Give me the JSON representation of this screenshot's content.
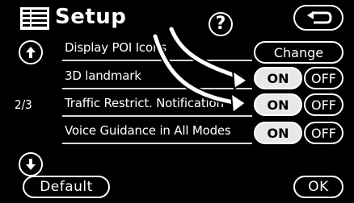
{
  "header": {
    "title": "Setup",
    "help_label": "?",
    "icons": [
      "menu-list-icon",
      "back-arrow-icon"
    ]
  },
  "nav": {
    "page_indicator": "2/3",
    "icons": [
      "scroll-up-icon",
      "scroll-down-icon"
    ]
  },
  "settings": [
    {
      "label": "Display POI Icons",
      "control": "button",
      "button_label": "Change"
    },
    {
      "label": "3D landmark",
      "control": "toggle",
      "on_label": "ON",
      "off_label": "OFF",
      "selected": "ON"
    },
    {
      "label": "Traffic Restrict. Notification",
      "control": "toggle",
      "on_label": "ON",
      "off_label": "OFF",
      "selected": "ON"
    },
    {
      "label": "Voice Guidance in All Modes",
      "control": "toggle",
      "on_label": "ON",
      "off_label": "OFF",
      "selected": "ON"
    }
  ],
  "footer": {
    "default_label": "Default",
    "ok_label": "OK"
  },
  "colors": {
    "background": "#000000",
    "foreground": "#ffffff",
    "selected_fill": "#e8e8e8"
  }
}
